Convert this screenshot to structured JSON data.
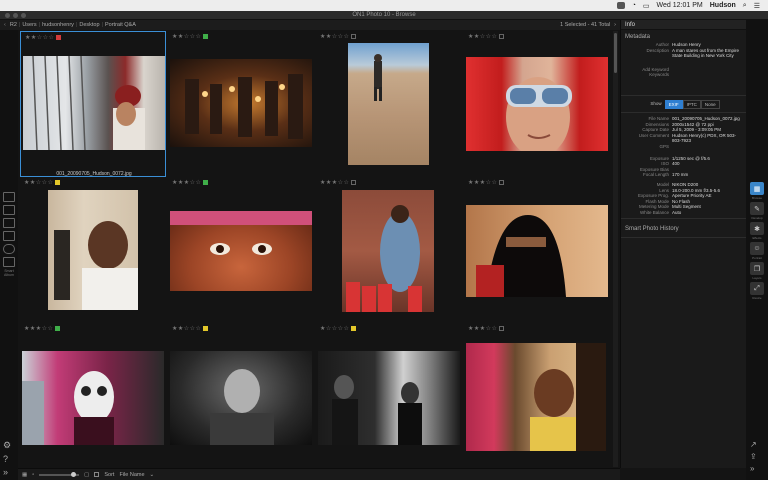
{
  "menubar": {
    "clock": "Wed 12:01 PM",
    "user": "Hudson"
  },
  "window": {
    "title": "ON1 Photo 10 - Browse"
  },
  "pathbar": {
    "crumbs": [
      "R2",
      "Users",
      "hudsonhenry",
      "Desktop",
      "Portrait Q&A"
    ],
    "selection_info": "1 Selected - 41 Total"
  },
  "leftstrip": {
    "labels": [
      "",
      "",
      "",
      "",
      "",
      "",
      "Smart Album"
    ]
  },
  "grid": {
    "cells": [
      {
        "stars": "★★☆☆☆",
        "label_color": "#d23b3b",
        "caption": "001_20090705_Hudson_0072.jpg",
        "selected": true
      },
      {
        "stars": "★★☆☆☆",
        "label_color": "#3fae49",
        "caption": ""
      },
      {
        "stars": "★★☆☆☆",
        "label_color": "",
        "caption": ""
      },
      {
        "stars": "★★☆☆☆",
        "label_color": "",
        "caption": ""
      },
      {
        "stars": "★★☆☆☆",
        "label_color": "#e3c72a",
        "caption": ""
      },
      {
        "stars": "★★★☆☆",
        "label_color": "#3fae49",
        "caption": ""
      },
      {
        "stars": "★★★☆☆",
        "label_color": "",
        "caption": ""
      },
      {
        "stars": "★★★☆☆",
        "label_color": "",
        "caption": ""
      },
      {
        "stars": "★★★☆☆",
        "label_color": "#3fae49",
        "caption": ""
      },
      {
        "stars": "★★☆☆☆",
        "label_color": "#e3c72a",
        "caption": ""
      },
      {
        "stars": "★☆☆☆☆",
        "label_color": "#e3c72a",
        "caption": ""
      },
      {
        "stars": "★★★☆☆",
        "label_color": "",
        "caption": ""
      }
    ]
  },
  "panel": {
    "header": "Info",
    "metadata_title": "Metadata",
    "metadata": [
      {
        "k": "Author",
        "v": "Hudson Henry"
      },
      {
        "k": "Description",
        "v": "A man stares out from the Empire State Building in New York City"
      },
      {
        "k": "Add Keyword",
        "v": ""
      },
      {
        "k": "Keywords",
        "v": ""
      }
    ],
    "toggle": {
      "show": "Show",
      "options": [
        "EXIF",
        "IPTC",
        "None"
      ],
      "active": "EXIF"
    },
    "exif": [
      {
        "k": "File Name",
        "v": "001_20090705_Hudson_0072.jpg"
      },
      {
        "k": "Dimensions",
        "v": "2000x1542 @ 72 ppi"
      },
      {
        "k": "Capture Date",
        "v": "Jul 5, 2009 - 3:09:05 PM"
      },
      {
        "k": "User Comment",
        "v": "Hudson Henry(c) PDX, OR 503-803-7923"
      },
      {
        "k": "GPS",
        "v": ""
      },
      {
        "k": "Exposure",
        "v": "1/1250 sec @ f/5.6"
      },
      {
        "k": "ISO",
        "v": "400"
      },
      {
        "k": "Exposure Bias",
        "v": ""
      },
      {
        "k": "Focal Length",
        "v": "170 mm"
      },
      {
        "k": "Model",
        "v": "NIKON D200"
      },
      {
        "k": "Lens",
        "v": "18.0-200.0 mm f/3.5-5.6"
      },
      {
        "k": "Exposure Prog.",
        "v": "Aperture Priority AE"
      },
      {
        "k": "Flash Mode",
        "v": "No Flash"
      },
      {
        "k": "Metering Mode",
        "v": "Multi Segment"
      },
      {
        "k": "White Balance",
        "v": "Auto"
      }
    ],
    "smart_history": "Smart Photo History"
  },
  "rightstrip": {
    "labels": [
      "Browse",
      "Develop",
      "Effects",
      "Portrait",
      "Layers",
      "Resize"
    ]
  },
  "footer": {
    "sort_label": "Sort",
    "sort_value": "File Name",
    "thumb_size": 0.9
  },
  "colors": {
    "accent": "#3b8fd6",
    "panel_bg": "#1a1a1a",
    "grid_bg": "#141414"
  }
}
